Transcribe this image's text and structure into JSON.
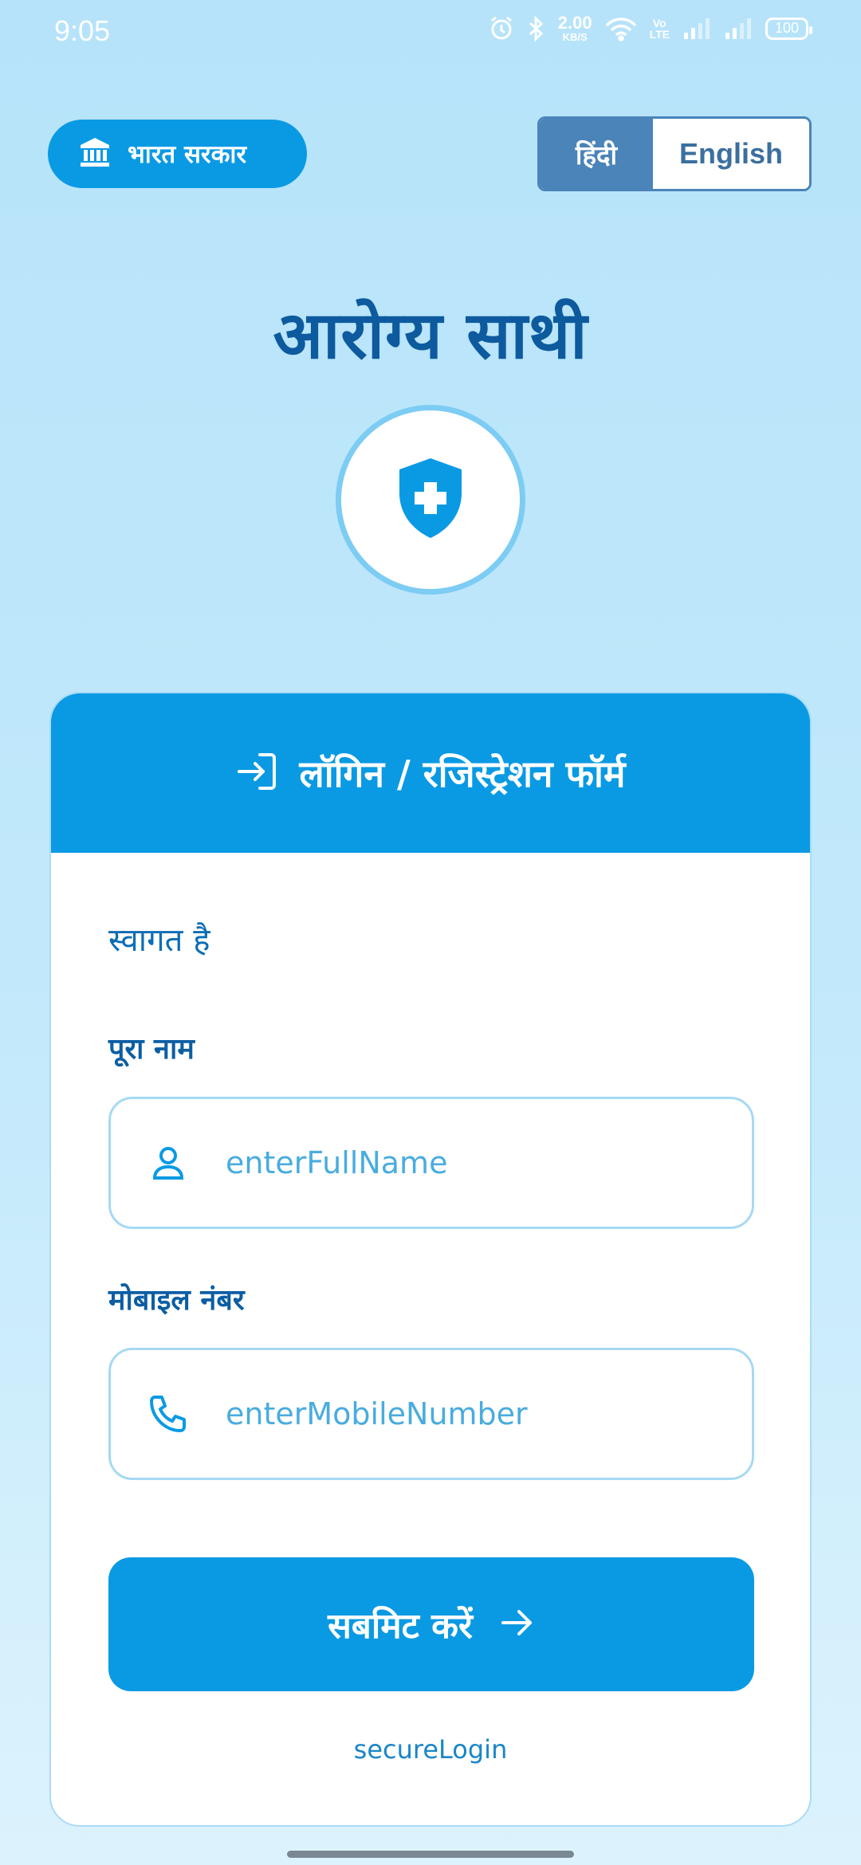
{
  "status_bar": {
    "time": "9:05",
    "net_speed_value": "2.00",
    "net_speed_unit": "KB/S",
    "volte_top": "Vo",
    "volte_bottom": "LTE",
    "battery": "100",
    "icons": [
      "alarm-icon",
      "bluetooth-icon",
      "wifi-icon",
      "signal-icon",
      "signal-icon",
      "battery-icon"
    ]
  },
  "header": {
    "gov_label": "भारत सरकार",
    "gov_icon": "government-building-icon",
    "lang_hindi": "हिंदी",
    "lang_english": "English",
    "selected_language": "हिंदी"
  },
  "app": {
    "title": "आरोग्य साथी",
    "logo_icon": "shield-plus-icon"
  },
  "form": {
    "header_icon": "login-icon",
    "header_title": "लॉगिन / रजिस्ट्रेशन फॉर्म",
    "welcome": "स्वागत है",
    "name_label": "पूरा नाम",
    "name_placeholder": "enterFullName",
    "name_icon": "user-icon",
    "mobile_label": "मोबाइल नंबर",
    "mobile_placeholder": "enterMobileNumber",
    "mobile_icon": "phone-icon",
    "submit_label": "सबमिट करें",
    "submit_icon": "arrow-right-icon",
    "footer": "secureLogin"
  },
  "colors": {
    "primary": "#0a9ae4",
    "dark_blue": "#0d5a9e",
    "toggle_blue": "#4a84b9",
    "background_top": "#b6e3fa",
    "background_bottom": "#dcf3fd"
  }
}
